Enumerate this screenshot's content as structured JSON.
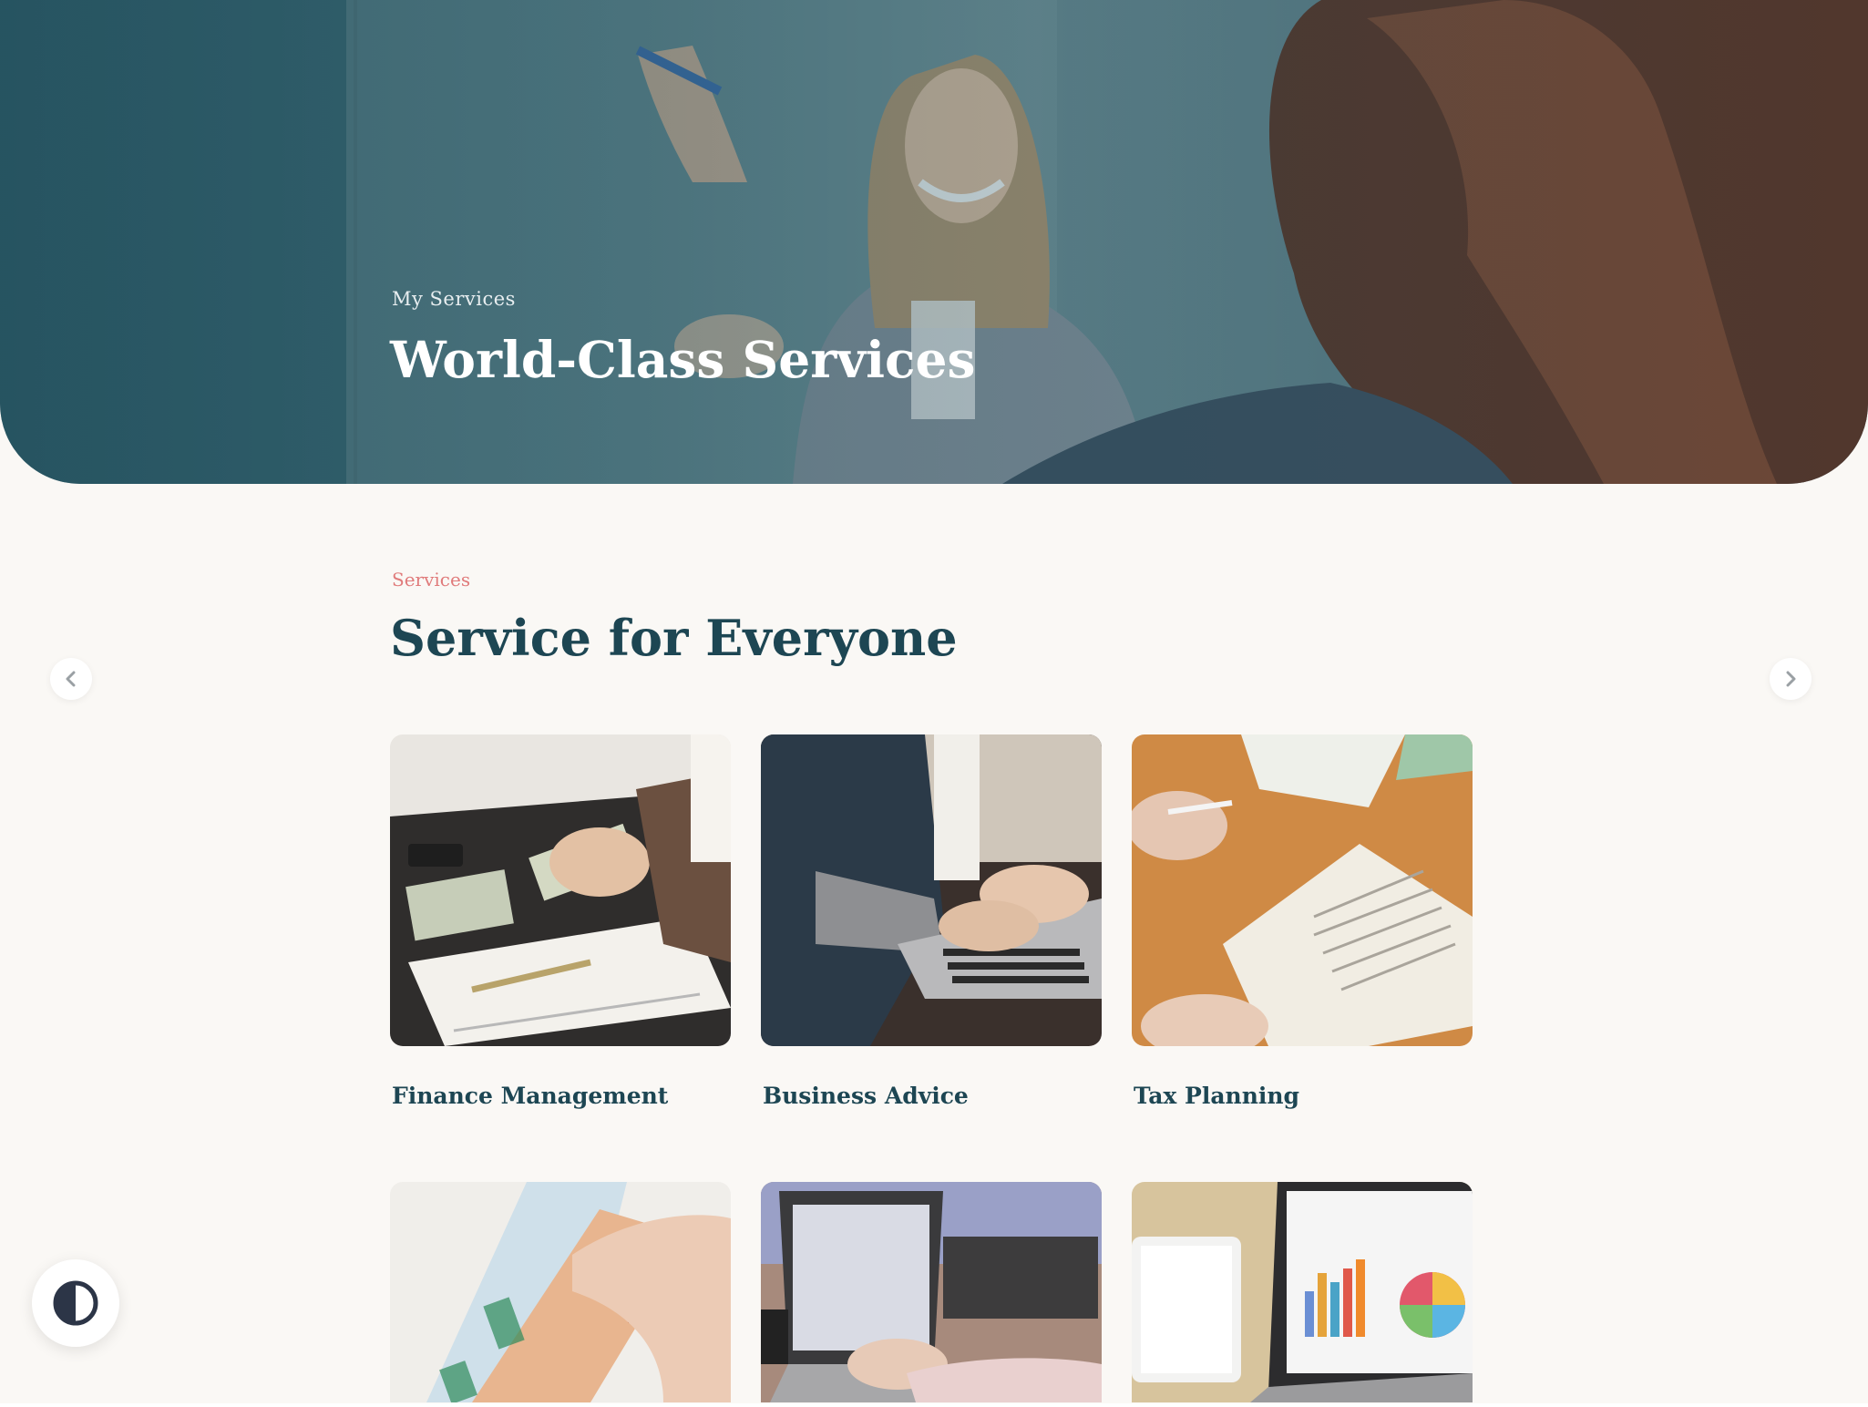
{
  "hero": {
    "eyebrow": "My Services",
    "title": "World-Class Services"
  },
  "services": {
    "eyebrow": "Services",
    "title": "Service for Everyone",
    "nav": {
      "prev_icon": "chevron-left-icon",
      "next_icon": "chevron-right-icon"
    },
    "cards": [
      {
        "title": "Finance Management",
        "image": "money-counting-photo"
      },
      {
        "title": "Business Advice",
        "image": "laptop-typing-photo"
      },
      {
        "title": "Tax Planning",
        "image": "open-book-photo"
      },
      {
        "image": "euro-banknotes-photo"
      },
      {
        "image": "laptop-meeting-photo"
      },
      {
        "image": "charts-on-laptop-photo"
      }
    ]
  },
  "accessibility": {
    "contrast_icon": "contrast-half-circle-icon"
  },
  "colors": {
    "accent": "#e07b7b",
    "heading": "#1d4653",
    "background": "#faf8f5",
    "hero_tint": "#2f5d6a"
  }
}
